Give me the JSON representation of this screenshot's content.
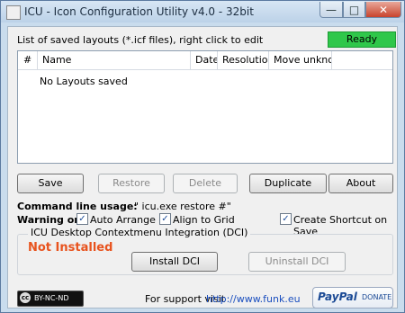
{
  "window": {
    "title": "ICU - Icon Configuration Utility v4.0 - 32bit",
    "minimize_glyph": "—",
    "maximize_glyph": "□",
    "close_glyph": "✕"
  },
  "header": {
    "caption": "List of saved layouts (*.icf files), right click to edit",
    "status": "Ready",
    "status_color": "#2fc74a"
  },
  "layouts_list": {
    "columns": [
      "#",
      "Name",
      "Date",
      "Resolution",
      "Move unkno..."
    ],
    "empty_message": "No Layouts saved"
  },
  "actions": {
    "save": "Save",
    "restore": "Restore",
    "delete": "Delete",
    "duplicate": "Duplicate",
    "about": "About"
  },
  "command_line": {
    "label": "Command line usage:",
    "value": "\" icu.exe restore #\""
  },
  "warning": {
    "label": "Warning on:",
    "auto_arrange": {
      "label": "Auto Arrange",
      "checked": true
    },
    "align_to_grid": {
      "label": "Align to Grid",
      "checked": true
    },
    "create_shortcut": {
      "label": "Create Shortcut on Save",
      "checked": true
    }
  },
  "dci": {
    "title": "ICU Desktop Contextmenu Integration (DCI)",
    "status": "Not Installed",
    "status_color": "#e8531e",
    "install": "Install DCI",
    "uninstall": "Uninstall DCI"
  },
  "footer": {
    "license": "BY-NC-ND",
    "cc_mark": "cc",
    "support_text": "For support visit",
    "support_link": "http://www.funk.eu",
    "paypal_logo": "PayPal",
    "paypal_donate": "DONATE"
  }
}
